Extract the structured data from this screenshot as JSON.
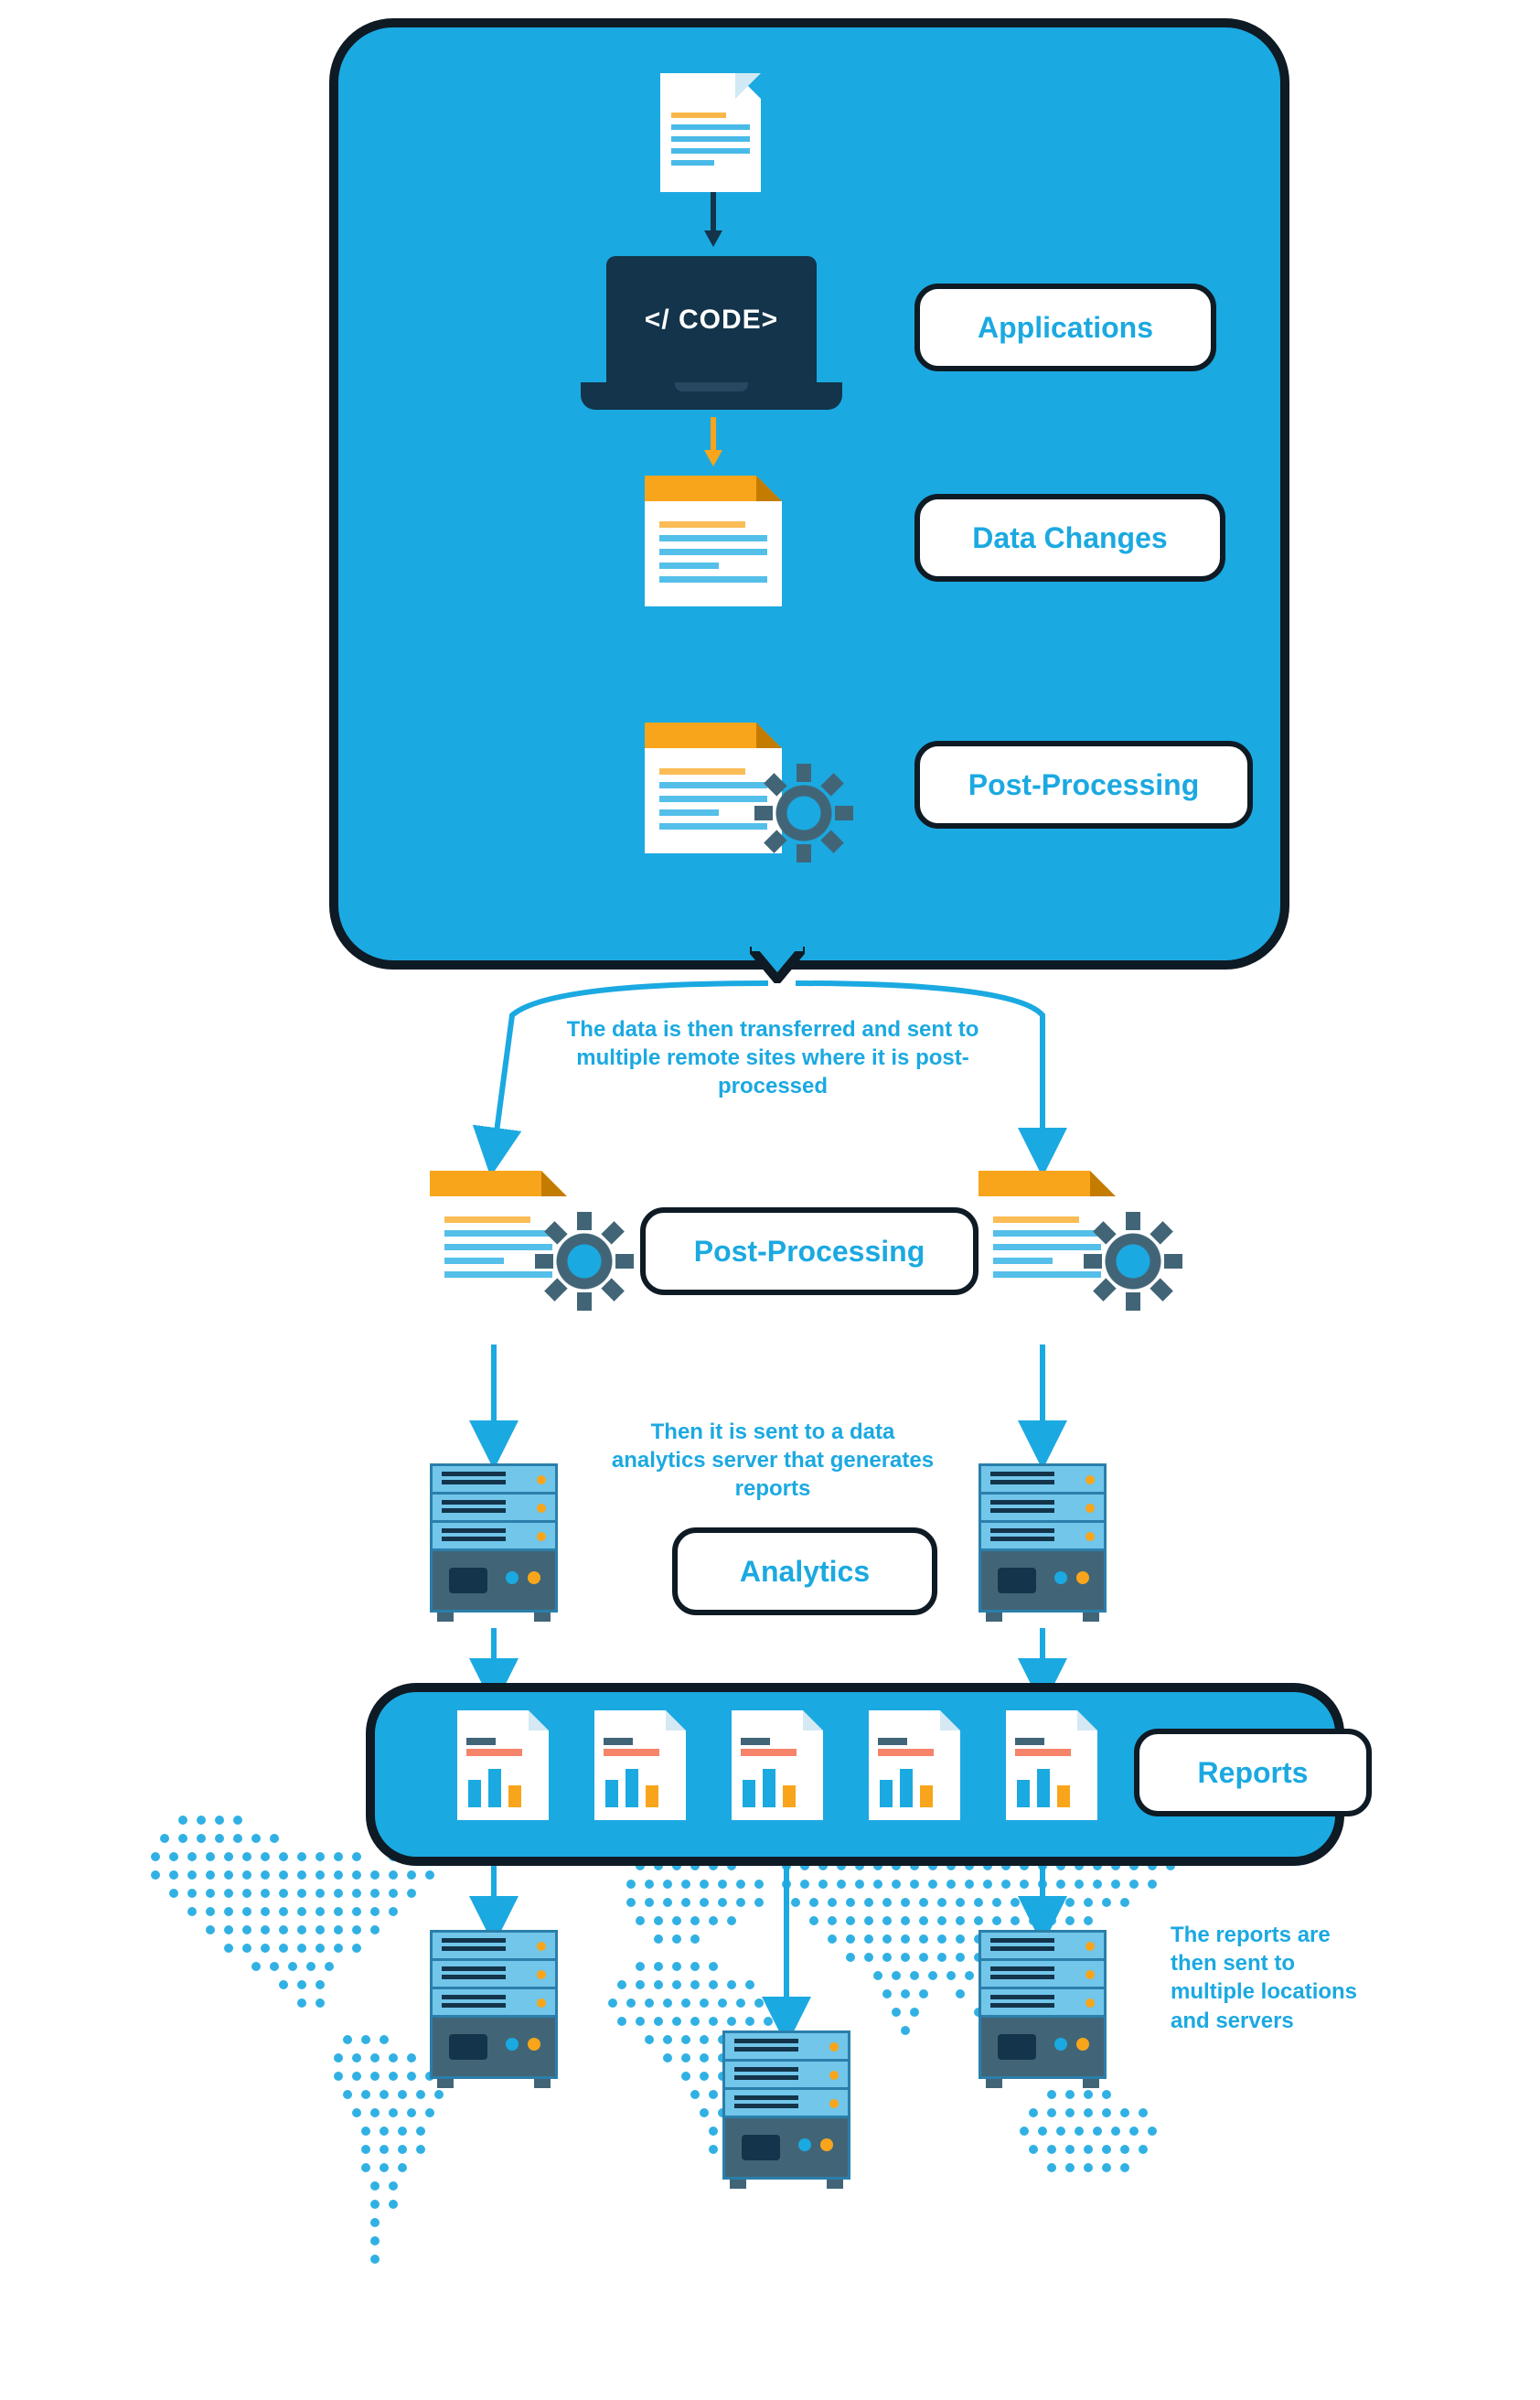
{
  "labels": {
    "applications": "Applications",
    "data_changes": "Data Changes",
    "post_processing_top": "Post-Processing",
    "post_processing_mid": "Post-Processing",
    "analytics": "Analytics",
    "reports": "Reports",
    "code": "</ CODE>"
  },
  "captions": {
    "transfer": "The data is then transferred and sent to multiple remote sites where it is post-processed",
    "analytics": "Then it is sent to a data analytics server that generates reports",
    "distribute": "The reports are then sent to multiple locations and servers"
  },
  "colors": {
    "blue": "#1ba9e1",
    "orange": "#f8a51b",
    "dark": "#0e1a24"
  },
  "structure": {
    "top_box": [
      "source_document",
      "laptop_code",
      "data_change_doc",
      "post_processing_doc_gear"
    ],
    "middle": [
      "post_processing_left",
      "post_processing_right",
      "analytics_server_left",
      "analytics_server_right"
    ],
    "reports_bar": {
      "report_count": 5
    },
    "distribution_servers": 3
  }
}
